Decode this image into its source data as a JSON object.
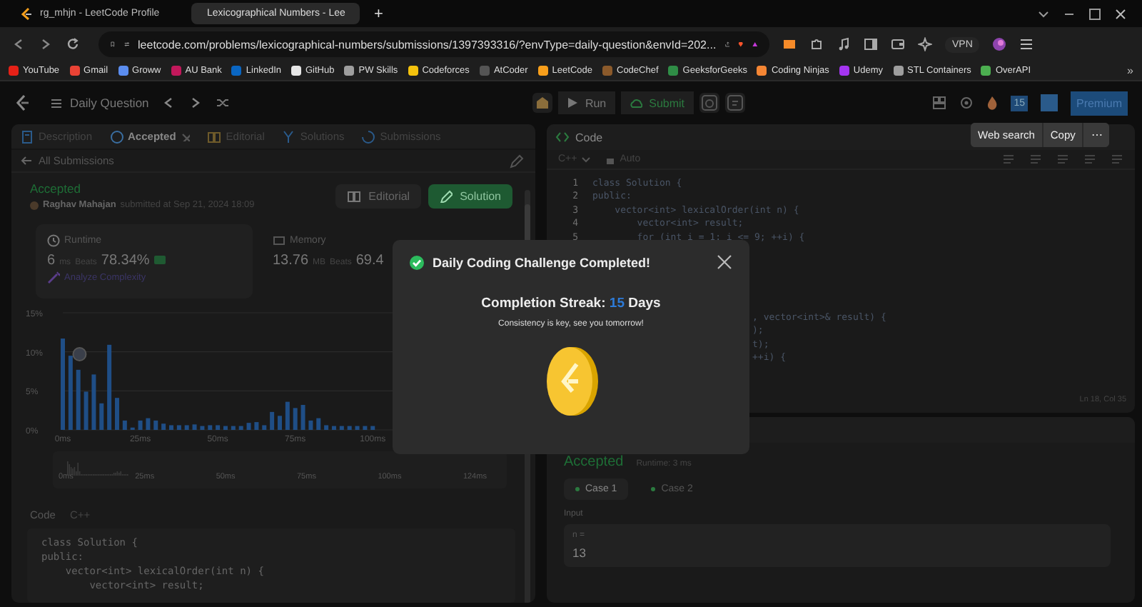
{
  "browser": {
    "tabs": [
      {
        "title": "rg_mhjn - LeetCode Profile",
        "selected": false
      },
      {
        "title": "Lexicographical Numbers - Lee",
        "selected": true
      }
    ],
    "new_tab": "+",
    "url": "leetcode.com/problems/lexicographical-numbers/submissions/1397393316/?envType=daily-question&envId=202...",
    "vpn": "VPN",
    "bookmarks": [
      {
        "label": "YouTube",
        "color": "#e62117"
      },
      {
        "label": "Gmail",
        "color": "#ea4335"
      },
      {
        "label": "Groww",
        "color": "#5b8def"
      },
      {
        "label": "AU Bank",
        "color": "#c2185b"
      },
      {
        "label": "LinkedIn",
        "color": "#0a66c2"
      },
      {
        "label": "GitHub",
        "color": "#e6e6e6"
      },
      {
        "label": "PW Skills",
        "color": "#9e9e9e"
      },
      {
        "label": "Codeforces",
        "color": "#f4c20d"
      },
      {
        "label": "AtCoder",
        "color": "#555555"
      },
      {
        "label": "LeetCode",
        "color": "#f89f1b"
      },
      {
        "label": "CodeChef",
        "color": "#8b5a2b"
      },
      {
        "label": "GeeksforGeeks",
        "color": "#2f8d46"
      },
      {
        "label": "Coding Ninjas",
        "color": "#f58634"
      },
      {
        "label": "Udemy",
        "color": "#a435f0"
      },
      {
        "label": "STL Containers",
        "color": "#9e9e9e"
      },
      {
        "label": "OverAPI",
        "color": "#4caf50"
      }
    ],
    "more_bookmarks": "»"
  },
  "toolbar": {
    "title": "Daily Question",
    "run": "Run",
    "submit": "Submit",
    "streak": "15",
    "premium": "Premium"
  },
  "selection_popup": {
    "buttons": [
      "Web search",
      "Copy"
    ],
    "more": "⋯"
  },
  "left_panel": {
    "tabs": [
      {
        "label": "Description",
        "selected": false,
        "closable": false
      },
      {
        "label": "Accepted",
        "selected": true,
        "closable": true
      },
      {
        "label": "Editorial",
        "selected": false,
        "closable": false
      },
      {
        "label": "Solutions",
        "selected": false,
        "closable": false
      },
      {
        "label": "Submissions",
        "selected": false,
        "closable": false
      }
    ],
    "back_link": "All Submissions",
    "status": "Accepted",
    "author": "Raghav Mahajan",
    "submitted": "submitted at Sep 21, 2024 18:09",
    "buttons": [
      {
        "label": "Editorial",
        "kind": "secondary"
      },
      {
        "label": "Solution",
        "kind": "primary"
      }
    ],
    "runtime": {
      "label": "Runtime",
      "value": "6",
      "unit": "ms",
      "beats_label": "Beats",
      "beats": "78.34%",
      "analyze": "Analyze Complexity"
    },
    "memory": {
      "label": "Memory",
      "value": "13.76",
      "unit": "MB",
      "beats_label": "Beats",
      "beats": "69.4"
    },
    "chart_data": {
      "type": "bar",
      "x": [
        0,
        2.5,
        5,
        7.5,
        10,
        12.5,
        15,
        17.5,
        20,
        22.5,
        25,
        27.5,
        30,
        32.5,
        35,
        37.5,
        40,
        42.5,
        45,
        47.5,
        50,
        52.5,
        55,
        57.5,
        60,
        62.5,
        65,
        67.5,
        70,
        72.5,
        75,
        77.5,
        80,
        82.5,
        85,
        87.5,
        90,
        92.5,
        95,
        97.5,
        100
      ],
      "values": [
        11.7,
        9.5,
        7.7,
        4.9,
        7.1,
        3.4,
        10.9,
        4.1,
        1.2,
        0.3,
        1.2,
        1.5,
        1.2,
        0.8,
        0.6,
        0.6,
        0.6,
        0.7,
        0.5,
        0.6,
        0.6,
        0.5,
        0.5,
        0.5,
        0.9,
        1.0,
        0.6,
        2.3,
        1.8,
        3.6,
        2.8,
        3.2,
        1.2,
        1.5,
        0.6,
        0.5,
        0.5,
        0.5,
        0.5,
        0.5,
        0.5
      ],
      "xticks": [
        {
          "value": 0,
          "label": "0ms"
        },
        {
          "value": 25,
          "label": "25ms"
        },
        {
          "value": 50,
          "label": "50ms"
        },
        {
          "value": 75,
          "label": "75ms"
        },
        {
          "value": 100,
          "label": "100ms"
        }
      ],
      "yticks": [
        {
          "value": 0,
          "label": "0%"
        },
        {
          "value": 5,
          "label": "5%"
        },
        {
          "value": 10,
          "label": "10%"
        },
        {
          "value": 15,
          "label": "15%"
        }
      ],
      "xlim": [
        0,
        146
      ],
      "ylim": [
        0,
        15
      ],
      "grid": true
    },
    "overview_ticks": [
      "0ms",
      "25ms",
      "50ms",
      "75ms",
      "100ms",
      "124ms"
    ],
    "code_label": "Code",
    "code_language": "C++",
    "code_lines": [
      {
        "text": "class Solution {"
      },
      {
        "text": "public:"
      },
      {
        "text": "    vector<int> lexicalOrder(int n) {"
      },
      {
        "text": "        vector<int> result;"
      }
    ]
  },
  "right_panel": {
    "title": "Code",
    "language": "C++",
    "mode": "Auto",
    "code_lines": [
      {
        "number": "1",
        "text": "class Solution {"
      },
      {
        "number": "2",
        "text": "public:"
      },
      {
        "number": "3",
        "text": "    vector<int> lexicalOrder(int n) {"
      },
      {
        "number": "4",
        "text": "        vector<int> result;"
      },
      {
        "number": "5",
        "text": "        for (int i = 1; i <= 9; ++i) {"
      }
    ],
    "code_fragments": [
      ", vector<int>& result) {",
      ");",
      "t);",
      "++i) {"
    ],
    "cursor": "Ln 18, Col 35",
    "result": {
      "status": "Accepted",
      "runtime": "Runtime: 3 ms",
      "cases": [
        {
          "label": "Case 1",
          "selected": true
        },
        {
          "label": "Case 2",
          "selected": false
        }
      ],
      "input_label": "Input",
      "var": "n =",
      "value": "13"
    }
  },
  "modal": {
    "title": "Daily Coding Challenge Completed!",
    "streak_label": "Completion Streak:",
    "streak": "15",
    "streak_unit": "Days",
    "message": "Consistency is key, see you tomorrow!"
  }
}
